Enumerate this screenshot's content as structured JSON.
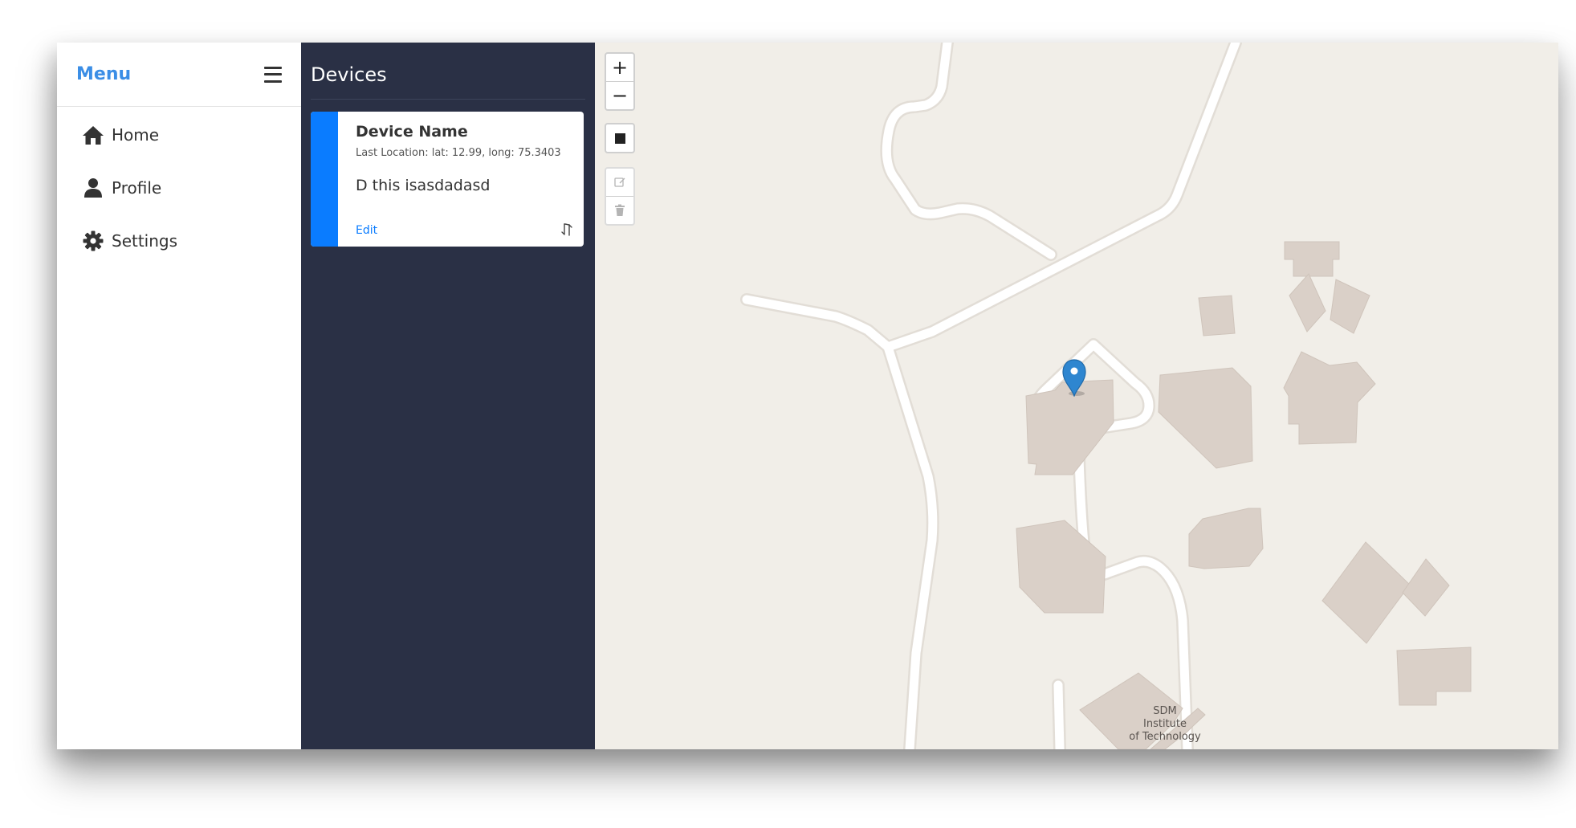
{
  "menu": {
    "title": "Menu",
    "items": [
      {
        "label": "Home",
        "icon": "home-icon"
      },
      {
        "label": "Profile",
        "icon": "user-icon"
      },
      {
        "label": "Settings",
        "icon": "gear-icon"
      }
    ]
  },
  "devices": {
    "title": "Devices",
    "card": {
      "name": "Device Name",
      "location": "Last Location: lat: 12.99, long: 75.3403",
      "description": "D this isasdadasd",
      "edit_label": "Edit"
    }
  },
  "map": {
    "zoom_in": "+",
    "zoom_out": "−",
    "label_lines": [
      "SDM",
      "Institute",
      "of Technology"
    ]
  },
  "colors": {
    "accent": "#3b8ee6",
    "card_accent": "#0a7cff",
    "devices_bg": "#2a3045",
    "map_bg": "#f1eee8",
    "building": "#dad0c8",
    "road": "#ffffff"
  }
}
